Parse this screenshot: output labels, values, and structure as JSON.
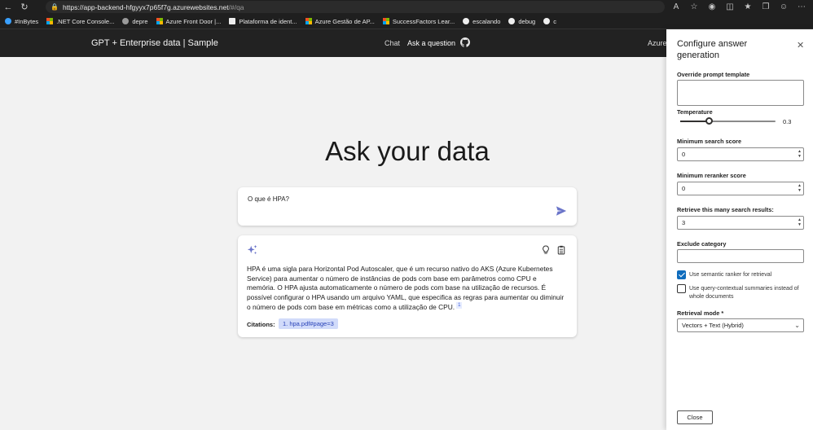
{
  "browser": {
    "url_host": "https://app-backend-hfgyyx7p65f7g.azurewebsites.net",
    "url_path": "/#/qa",
    "bookmarks": [
      {
        "label": "#InBytes",
        "color": "#3aa0ff"
      },
      {
        "label": ".NET Core Console...",
        "color": "#ms"
      },
      {
        "label": "depre",
        "color": "#9a9a9a"
      },
      {
        "label": "Azure Front Door |...",
        "color": "#ms"
      },
      {
        "label": "Plataforma de ident...",
        "color": "#eeeeee"
      },
      {
        "label": "Azure Gestão de AP...",
        "color": "#ms"
      },
      {
        "label": "SuccessFactors Lear...",
        "color": "#ms"
      },
      {
        "label": "escalando",
        "color": "#eeeeee"
      },
      {
        "label": "debug",
        "color": "#eeeeee"
      },
      {
        "label": "c",
        "color": "#eeeeee"
      }
    ]
  },
  "header": {
    "title": "GPT + Enterprise data | Sample",
    "nav_chat": "Chat",
    "nav_ask": "Ask a question",
    "azure_label": "Azure"
  },
  "main": {
    "hero": "Ask your data",
    "question": "O que é HPA?",
    "answer": "HPA é uma sigla para Horizontal Pod Autoscaler, que é um recurso nativo do AKS (Azure Kubernetes Service) para aumentar o número de instâncias de pods com base em parâmetros como CPU e memória. O HPA ajusta automaticamente o número de pods com base na utilização de recursos. É possível configurar o HPA usando um arquivo YAML, que especifica as regras para aumentar ou diminuir o número de pods com base em métricas como a utilização de CPU.",
    "answer_sup": "1",
    "citations_label": "Citations:",
    "citation": "1. hpa.pdf#page=3"
  },
  "panel": {
    "title": "Configure answer generation",
    "override_label": "Override prompt template",
    "temperature_label": "Temperature",
    "temperature_value": "0.3",
    "temperature_fraction": 0.3,
    "min_search_label": "Minimum search score",
    "min_search_value": "0",
    "min_reranker_label": "Minimum reranker score",
    "min_reranker_value": "0",
    "retrieve_label": "Retrieve this many search results:",
    "retrieve_value": "3",
    "exclude_label": "Exclude category",
    "semantic_label": "Use semantic ranker for retrieval",
    "semantic_checked": true,
    "contextual_label": "Use query-contextual summaries instead of whole documents",
    "contextual_checked": false,
    "mode_label": "Retrieval mode *",
    "mode_value": "Vectors + Text (Hybrid)",
    "close_label": "Close"
  },
  "colors": {
    "accent": "#0f6cbd",
    "citation_bg": "#d1dbfa",
    "send": "#6a74c9"
  }
}
